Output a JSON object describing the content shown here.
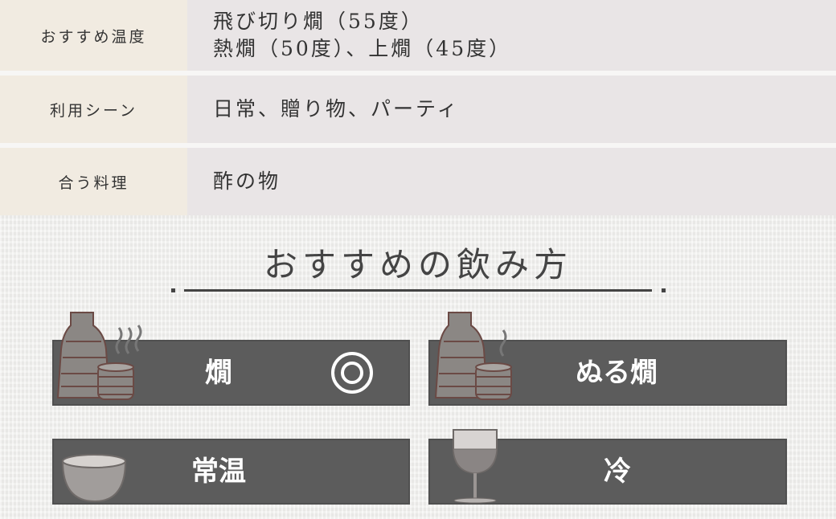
{
  "info_table": {
    "rows": [
      {
        "label": "おすすめ温度",
        "lines": [
          "飛び切り燗（55度）",
          "熱燗（50度）、上燗（45度）"
        ]
      },
      {
        "label": "利用シーン",
        "lines": [
          "日常、贈り物、パーティ"
        ]
      },
      {
        "label": "合う料理",
        "lines": [
          "酢の物"
        ]
      }
    ]
  },
  "section": {
    "title": "おすすめの飲み方"
  },
  "methods": [
    {
      "label": "燗",
      "icon": "tokkuri-steam-icon",
      "rating": "double-circle"
    },
    {
      "label": "ぬる燗",
      "icon": "tokkuri-light-steam-icon"
    },
    {
      "label": "常温",
      "icon": "sake-bowl-icon"
    },
    {
      "label": "冷",
      "icon": "wine-glass-icon"
    }
  ],
  "colors": {
    "card": "#5c5c5c",
    "label_bg": "#f1ebe1",
    "value_bg": "#e9e5e6"
  }
}
